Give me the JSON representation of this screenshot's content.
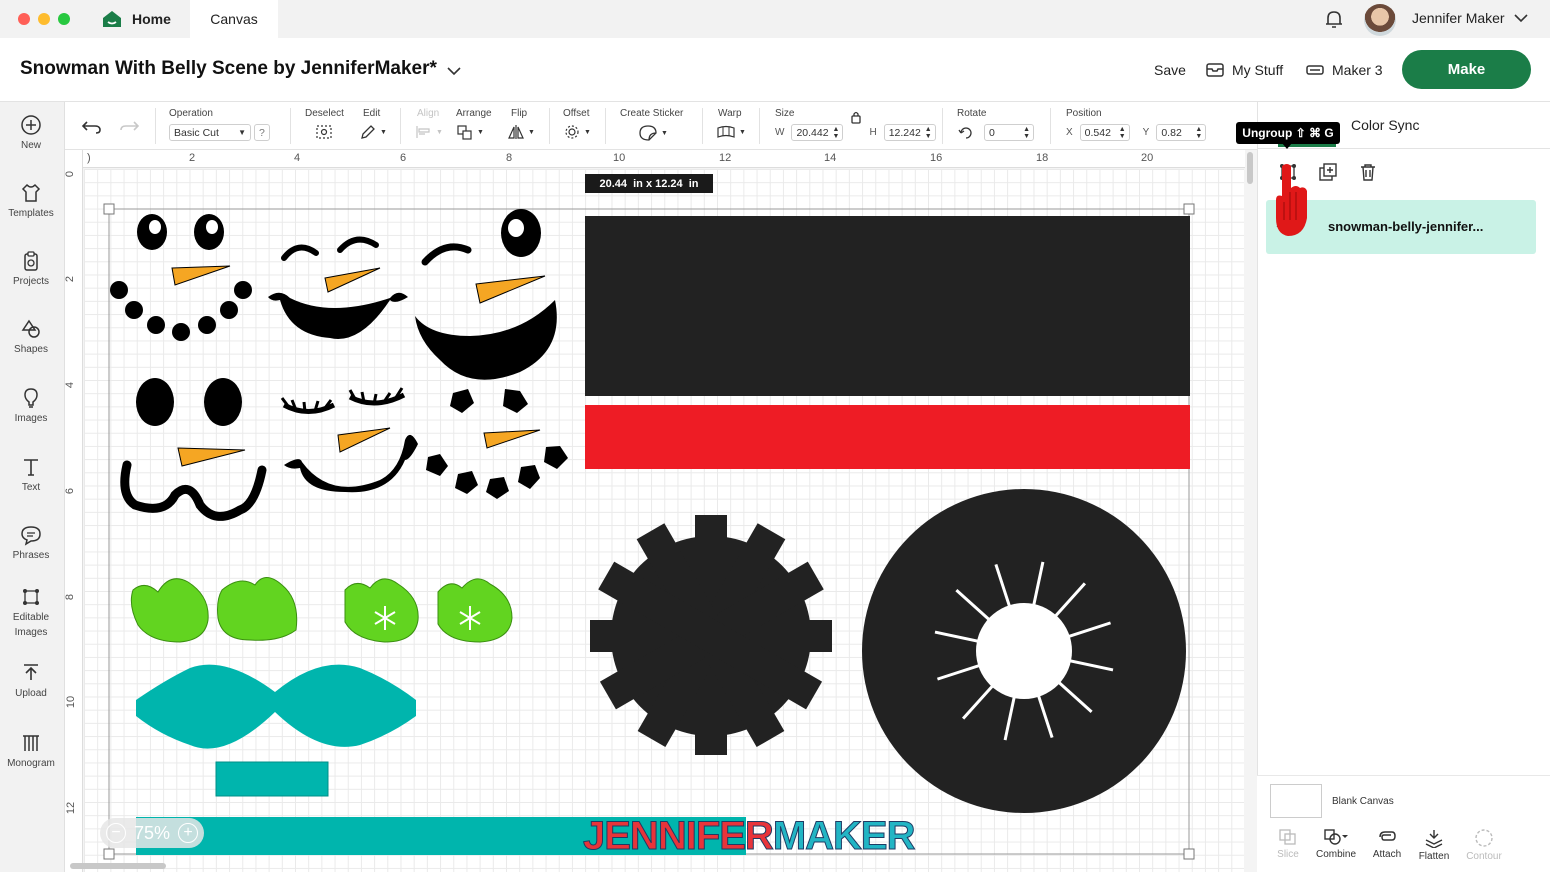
{
  "tabs": {
    "home": "Home",
    "canvas": "Canvas"
  },
  "user": {
    "name": "Jennifer Maker"
  },
  "project": {
    "title": "Snowman With Belly Scene by JenniferMaker*"
  },
  "header": {
    "save": "Save",
    "my_stuff": "My Stuff",
    "machine": "Maker 3",
    "make": "Make"
  },
  "sidebar": [
    {
      "label": "New",
      "icon": "plus-circle-icon"
    },
    {
      "label": "Templates",
      "icon": "shirt-icon"
    },
    {
      "label": "Projects",
      "icon": "clipboard-icon"
    },
    {
      "label": "Shapes",
      "icon": "shapes-icon"
    },
    {
      "label": "Images",
      "icon": "bulb-icon"
    },
    {
      "label": "Text",
      "icon": "text-icon"
    },
    {
      "label": "Phrases",
      "icon": "speech-bubble-icon"
    },
    {
      "label": "Editable Images",
      "icon": "editable-images-icon"
    },
    {
      "label": "Upload",
      "icon": "upload-icon"
    },
    {
      "label": "Monogram",
      "icon": "monogram-icon"
    }
  ],
  "toolbar": {
    "operation_label": "Operation",
    "operation_value": "Basic Cut",
    "help": "?",
    "deselect": "Deselect",
    "edit": "Edit",
    "align": "Align",
    "arrange": "Arrange",
    "flip": "Flip",
    "offset": "Offset",
    "create_sticker": "Create Sticker",
    "warp": "Warp",
    "size": "Size",
    "w_label": "W",
    "w_value": "20.442",
    "h_label": "H",
    "h_value": "12.242",
    "rotate": "Rotate",
    "rotate_value": "0",
    "position": "Position",
    "x_label": "X",
    "x_value": "0.542",
    "y_label": "Y",
    "y_value": "0.82"
  },
  "ruler": {
    "top": [
      "2",
      "4",
      "6",
      "8",
      "10",
      "12",
      "14",
      "16",
      "18",
      "20"
    ],
    "left": [
      "0",
      "2",
      "4",
      "6",
      "8",
      "10",
      "12"
    ]
  },
  "canvas": {
    "dimension_badge": "20.44  in x 12.24  in",
    "zoom": "75%",
    "watermark_a": "JENNIFER",
    "watermark_b": "MAKER"
  },
  "right_panel": {
    "tooltip": "Ungroup ⇧ ⌘ G",
    "color_sync": "Color Sync",
    "layer_name": "snowman-belly-jennifer...",
    "blank_canvas": "Blank Canvas",
    "actions": [
      "Slice",
      "Combine",
      "Attach",
      "Flatten",
      "Contour"
    ]
  },
  "colors": {
    "make_green": "#1b7d48",
    "layer_highlight": "#c9f2e6",
    "snowman_black": "#000000",
    "belly_dark": "#222222",
    "scarf_red": "#ee1c25",
    "carrot_orange": "#f5a623",
    "mitten_green": "#62d420",
    "teal": "#00b5ad"
  }
}
